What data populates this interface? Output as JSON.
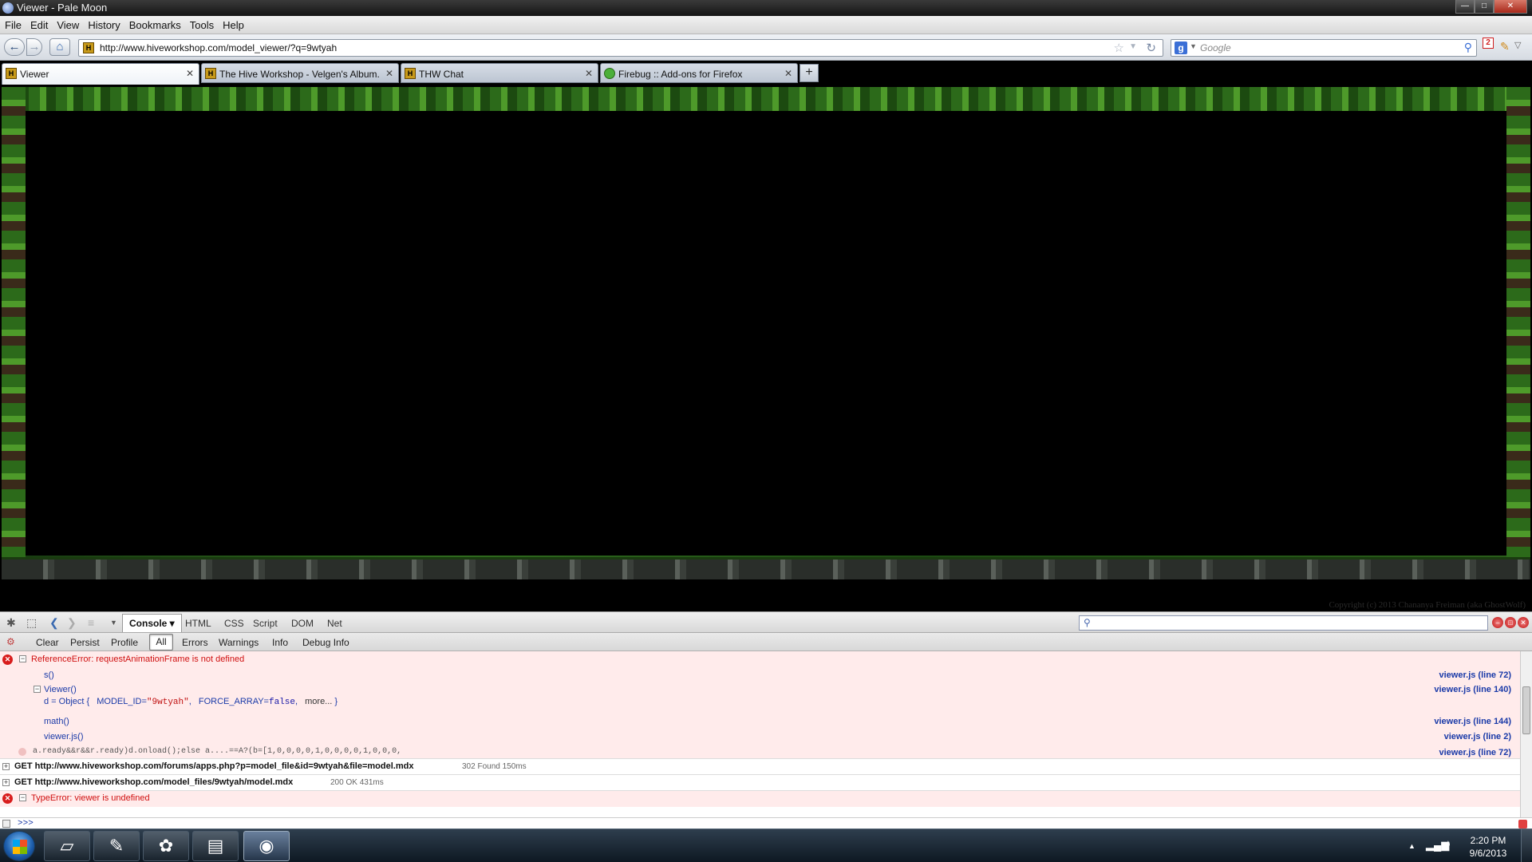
{
  "window": {
    "title": "Viewer - Pale Moon",
    "controls": {
      "minimize": "—",
      "maximize": "□",
      "close": "✕"
    }
  },
  "menu": [
    "File",
    "Edit",
    "View",
    "History",
    "Bookmarks",
    "Tools",
    "Help"
  ],
  "nav": {
    "back": "←",
    "forward": "→",
    "home": "⌂",
    "url": "http://www.hiveworkshop.com/model_viewer/?q=9wtyah",
    "search_engine": "g",
    "search_placeholder": "Google",
    "notification_count": "2"
  },
  "tabs": [
    {
      "label": "Viewer",
      "favicon": "hive-icon",
      "active": true
    },
    {
      "label": "The Hive Workshop - Velgen's Album...",
      "favicon": "hive-icon",
      "active": false
    },
    {
      "label": "THW Chat",
      "favicon": "hive-icon",
      "active": false
    },
    {
      "label": "Firebug :: Add-ons for Firefox",
      "favicon": "firebug-icon",
      "active": false
    }
  ],
  "new_tab": "+",
  "content": {
    "copyright": "Copyright (c) 2013 Chananya Freiman (aka GhostWolf)"
  },
  "firebug": {
    "panels": {
      "console": "Console",
      "html": "HTML",
      "css": "CSS",
      "script": "Script",
      "dom": "DOM",
      "net": "Net"
    },
    "filters": {
      "clear": "Clear",
      "persist": "Persist",
      "profile": "Profile",
      "all": "All",
      "errors": "Errors",
      "warnings": "Warnings",
      "info": "Info",
      "debug_info": "Debug Info"
    },
    "log": {
      "error1": "ReferenceError: requestAnimationFrame is not defined",
      "stack": [
        {
          "fn": "s()",
          "src": "viewer.js (line 72)"
        },
        {
          "fn": "Viewer()",
          "src": "viewer.js (line 140)"
        },
        {
          "fn": "math()",
          "src": "viewer.js (line 144)"
        },
        {
          "fn": "viewer.js()",
          "src": "viewer.js (line 2)"
        }
      ],
      "object_line": {
        "prefix": "d = Object {",
        "key1": "MODEL_ID=",
        "val1": "\"9wtyah\"",
        "key2": "FORCE_ARRAY=",
        "val2": "false",
        "more": "more...",
        "suffix": "}"
      },
      "code_line": "a.ready&&r&&r.ready)d.onload();else a....==A?(b=[1,0,0,0,0,1,0,0,0,0,1,0,0,0,",
      "code_src": "viewer.js (line 72)",
      "request1": {
        "text": "GET http://www.hiveworkshop.com/forums/apps.php?p=model_file&id=9wtyah&file=model.mdx",
        "status": "302 Found  150ms"
      },
      "request2": {
        "text": "GET http://www.hiveworkshop.com/model_files/9wtyah/model.mdx",
        "status": "200 OK  431ms"
      },
      "error2": "TypeError: viewer is undefined"
    },
    "command_prompt": ">>>"
  },
  "taskbar": {
    "clock_time": "2:20 PM",
    "clock_date": "9/6/2013"
  }
}
